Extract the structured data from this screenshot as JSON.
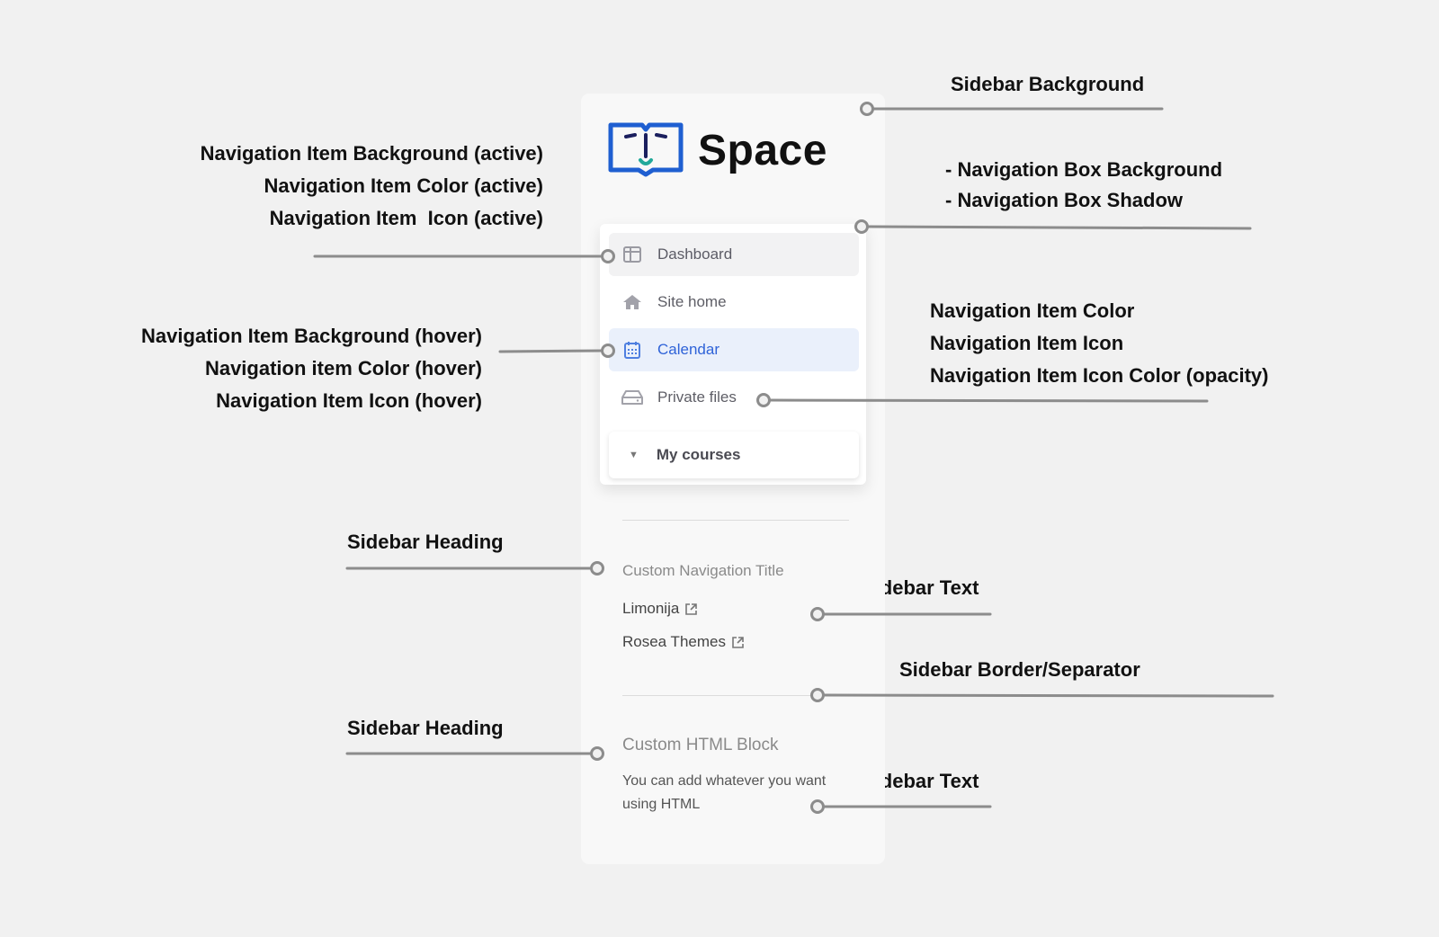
{
  "annotations": {
    "sidebar_background": "Sidebar Background",
    "nav_box": [
      "- Navigation Box Background",
      "- Navigation Box Shadow"
    ],
    "nav_active": [
      "Navigation Item Background (active)",
      "Navigation Item Color (active)",
      "Navigation Item  Icon (active)"
    ],
    "nav_hover": [
      "Navigation Item Background (hover)",
      "Navigation item Color (hover)",
      "Navigation Item Icon (hover)"
    ],
    "nav_item": [
      "Navigation Item Color",
      "Navigation Item Icon",
      "Navigation Item Icon Color (opacity)"
    ],
    "sidebar_heading_1": "Sidebar Heading",
    "sidebar_text_1": "Sidebar Text",
    "sidebar_separator": "Sidebar Border/Separator",
    "sidebar_heading_2": "Sidebar Heading",
    "sidebar_text_2": "Sidebar Text"
  },
  "logo": {
    "text": "Space",
    "icon": "open-book-face-icon"
  },
  "nav": {
    "items": [
      {
        "label": "Dashboard",
        "icon": "layout-icon",
        "state": "active"
      },
      {
        "label": "Site home",
        "icon": "home-icon",
        "state": "normal"
      },
      {
        "label": "Calendar",
        "icon": "calendar-icon",
        "state": "hover"
      },
      {
        "label": "Private files",
        "icon": "drive-icon",
        "state": "normal"
      }
    ],
    "my_courses": "My courses"
  },
  "blocks": {
    "custom_nav_title": "Custom Navigation Title",
    "links": [
      "Limonija",
      "Rosea Themes"
    ],
    "html_block_title": "Custom HTML Block",
    "html_block_text": "You can add whatever you want using HTML"
  },
  "colors": {
    "page_bg": "#f1f1f1",
    "sidebar_bg": "#f8f8f8",
    "nav_box_bg": "#ffffff",
    "active_bg": "#f2f2f3",
    "hover_bg": "#eaf0fb",
    "hover_color": "#2f63d8",
    "logo_blue": "#1f5fd1",
    "logo_teal": "#22a99a",
    "logo_navy": "#1b1f5e"
  }
}
